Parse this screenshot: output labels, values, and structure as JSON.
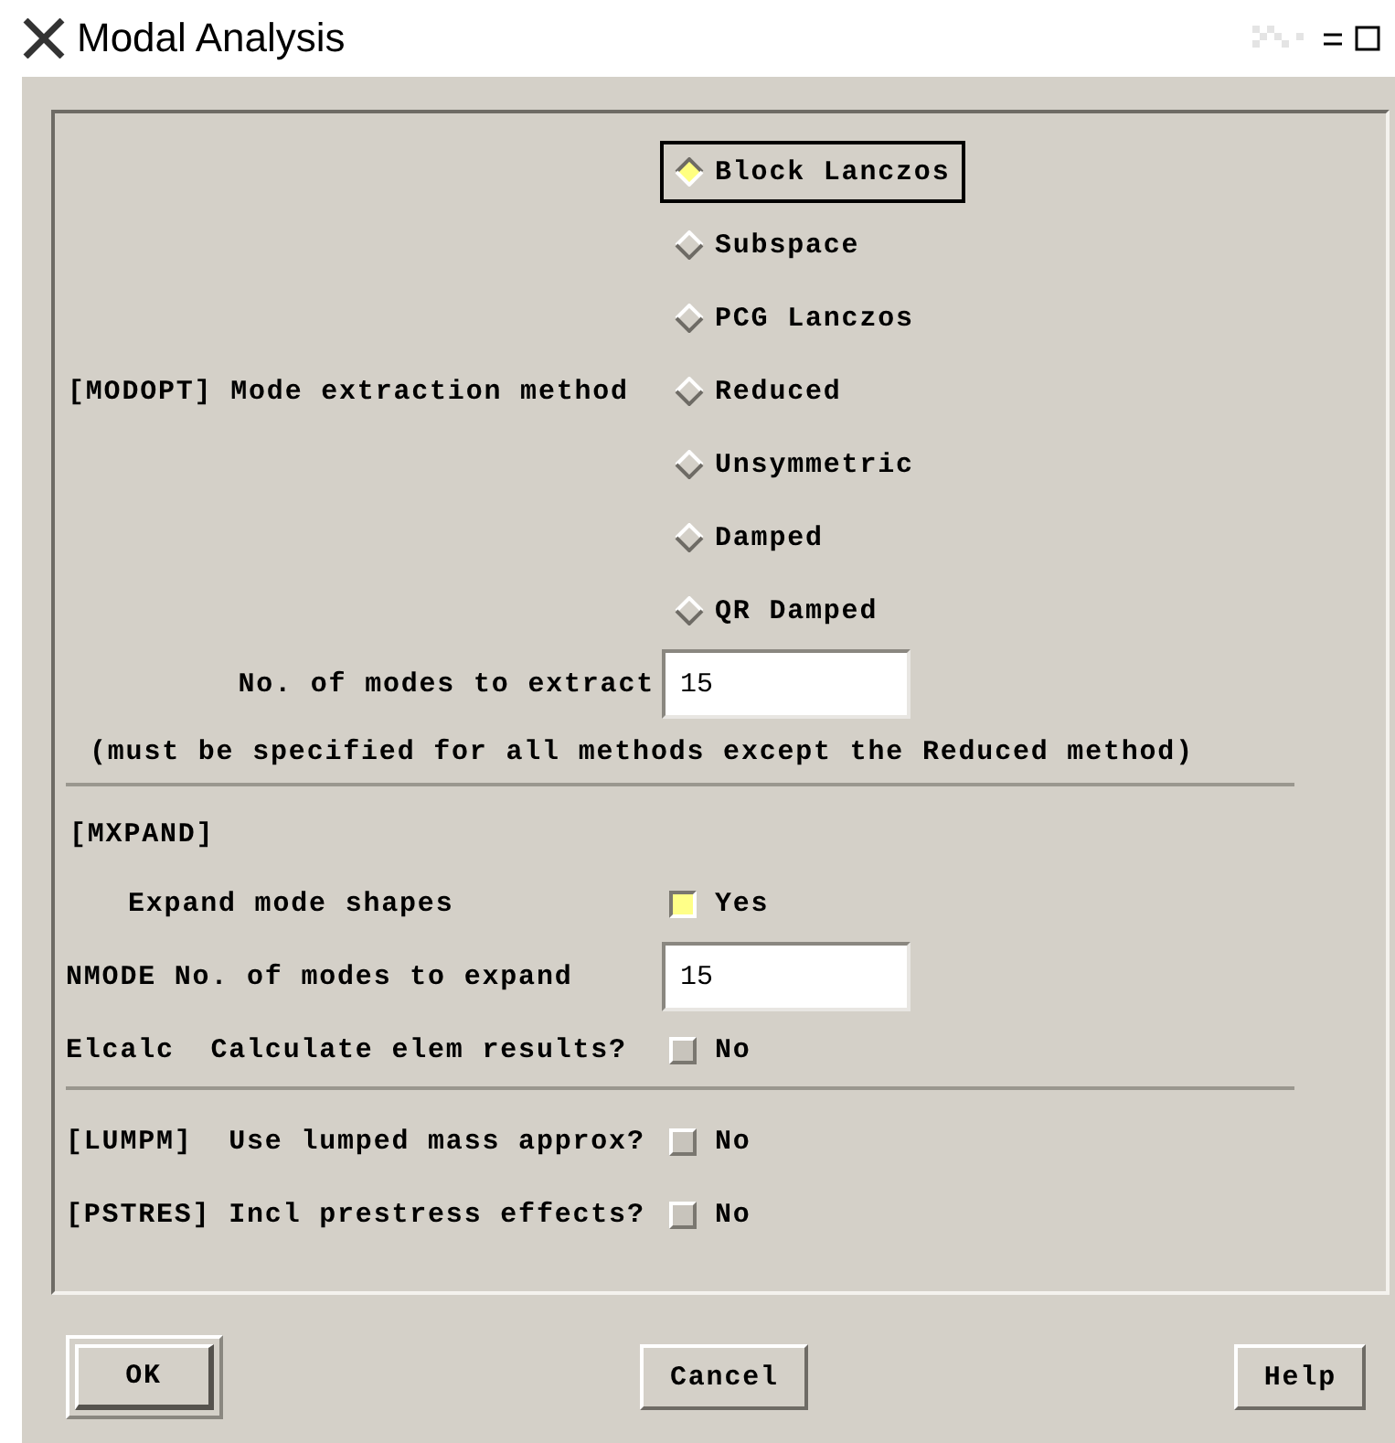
{
  "window": {
    "title": "Modal Analysis"
  },
  "sections": [
    {
      "rows": [
        {
          "kind": "radio",
          "label": "[MODOPT] Mode extraction method",
          "options": [
            {
              "label": "Block Lanczos",
              "selected": true,
              "focused": true
            },
            {
              "label": "Subspace",
              "selected": false,
              "focused": false
            },
            {
              "label": "PCG Lanczos",
              "selected": false,
              "focused": false
            },
            {
              "label": "Reduced",
              "selected": false,
              "focused": false
            },
            {
              "label": "Unsymmetric",
              "selected": false,
              "focused": false
            },
            {
              "label": "Damped",
              "selected": false,
              "focused": false
            },
            {
              "label": "QR Damped",
              "selected": false,
              "focused": false
            }
          ]
        },
        {
          "kind": "field",
          "label": "No. of modes to extract",
          "value": "15"
        },
        {
          "kind": "note",
          "label": "(must be specified for all methods except the Reduced method)"
        }
      ]
    },
    {
      "heading": "[MXPAND]",
      "rows": [
        {
          "kind": "checkbox",
          "label": "Expand mode shapes",
          "option": "Yes",
          "checked": true
        },
        {
          "kind": "field",
          "label": "NMODE No. of modes to expand",
          "value": "15"
        },
        {
          "kind": "checkbox",
          "label": "Elcalc  Calculate elem results?",
          "option": "No",
          "checked": false
        }
      ]
    },
    {
      "rows": [
        {
          "kind": "checkbox",
          "label": "[LUMPM]  Use lumped mass approx?",
          "option": "No",
          "checked": false
        },
        {
          "kind": "checkbox",
          "label": "[PSTRES] Incl prestress effects?",
          "option": "No",
          "checked": false
        }
      ]
    }
  ],
  "buttons": [
    {
      "label": "OK",
      "default": true
    },
    {
      "label": "Cancel",
      "default": false
    },
    {
      "label": "Help",
      "default": false
    }
  ]
}
